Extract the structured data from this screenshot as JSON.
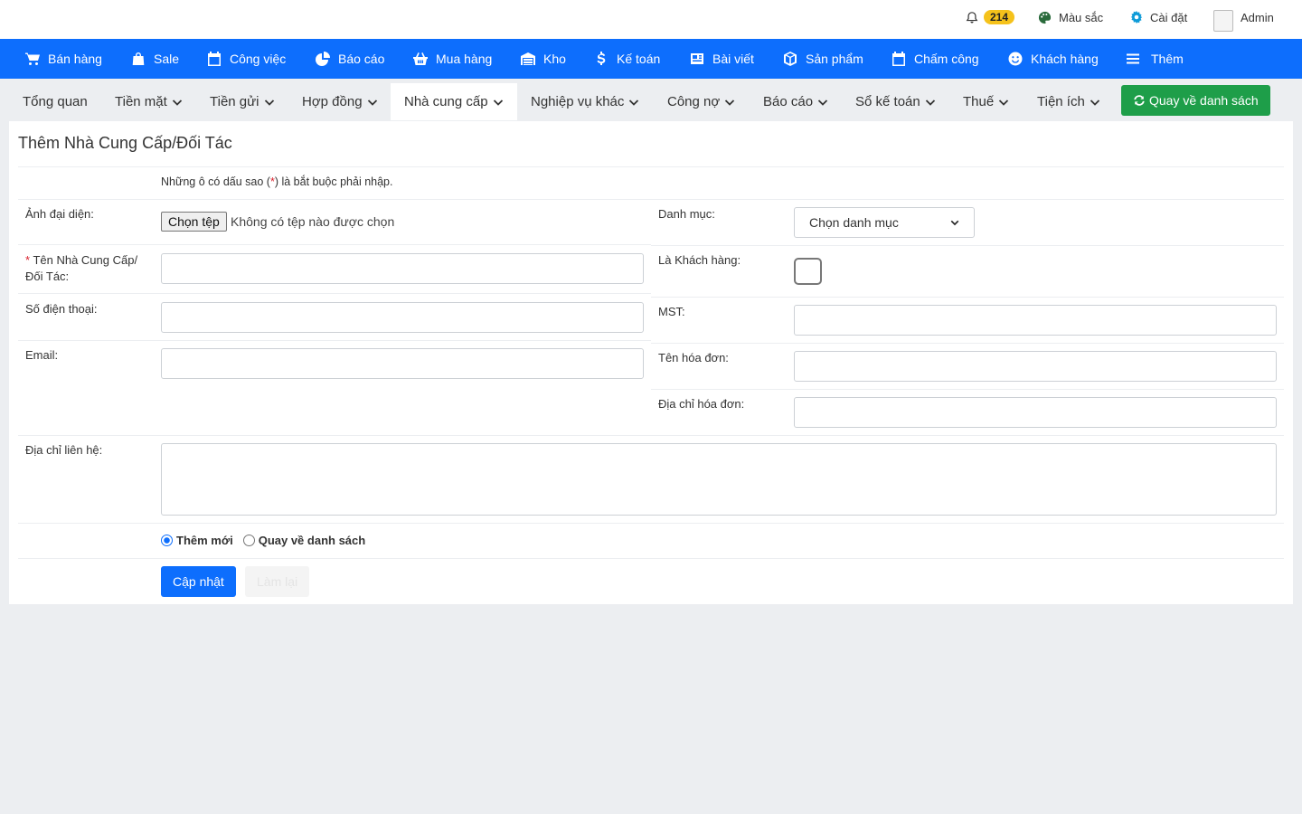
{
  "topbar": {
    "notifications": {
      "icon": "bell-icon",
      "count": "214"
    },
    "color": {
      "icon": "palette-icon",
      "label": "Màu sắc"
    },
    "settings": {
      "icon": "gear-icon",
      "label": "Cài đặt"
    },
    "user": {
      "icon": "avatar-image",
      "name": "Admin"
    }
  },
  "main_nav": [
    {
      "icon": "cart-icon",
      "label": "Bán hàng"
    },
    {
      "icon": "bag-icon",
      "label": "Sale"
    },
    {
      "icon": "calendar-icon",
      "label": "Công việc"
    },
    {
      "icon": "pie-chart-icon",
      "label": "Báo cáo"
    },
    {
      "icon": "basket-icon",
      "label": "Mua hàng"
    },
    {
      "icon": "warehouse-icon",
      "label": "Kho"
    },
    {
      "icon": "dollar-icon",
      "label": "Kế toán"
    },
    {
      "icon": "newspaper-icon",
      "label": "Bài viết"
    },
    {
      "icon": "box-icon",
      "label": "Sản phẩm"
    },
    {
      "icon": "calendar-icon",
      "label": "Chấm công"
    },
    {
      "icon": "smile-icon",
      "label": "Khách hàng"
    },
    {
      "icon": "menu-icon",
      "label": "Thêm"
    }
  ],
  "sub_nav": {
    "tabs": [
      {
        "label": "Tổng quan",
        "dropdown": false
      },
      {
        "label": "Tiền mặt",
        "dropdown": true
      },
      {
        "label": "Tiền gửi",
        "dropdown": true
      },
      {
        "label": "Hợp đồng",
        "dropdown": true
      },
      {
        "label": "Nhà cung cấp",
        "dropdown": true,
        "active": true
      },
      {
        "label": "Nghiệp vụ khác",
        "dropdown": true
      },
      {
        "label": "Công nợ",
        "dropdown": true
      },
      {
        "label": "Báo cáo",
        "dropdown": true
      },
      {
        "label": "Sổ kế toán",
        "dropdown": true
      },
      {
        "label": "Thuế",
        "dropdown": true
      },
      {
        "label": "Tiện ích",
        "dropdown": true
      }
    ],
    "back_button": {
      "icon": "refresh-icon",
      "label": "Quay về danh sách"
    }
  },
  "form": {
    "title": "Thêm Nhà Cung Cấp/Đối Tác",
    "note_before": "Những ô có dấu sao (",
    "note_star": "*",
    "note_after": ") là bắt buộc phải nhập.",
    "avatar_label": "Ảnh đại diện:",
    "file_button": "Chọn tệp",
    "file_status": "Không có tệp nào được chọn",
    "category_label": "Danh mục:",
    "category_value": "Chọn danh mục",
    "name_required": "*",
    "name_label_1": " Tên Nhà Cung Cấp/",
    "name_label_2": "Đối Tác:",
    "is_customer_label": "Là Khách hàng:",
    "is_customer_checked": false,
    "phone_label": "Số điện thoại:",
    "tax_label": "MST:",
    "email_label": "Email:",
    "invoice_name_label": "Tên hóa đơn:",
    "invoice_address_label": "Địa chỉ hóa đơn:",
    "contact_address_label": "Địa chỉ liên hệ:",
    "radio_options": [
      {
        "label": "Thêm mới",
        "checked": true
      },
      {
        "label": "Quay về danh sách",
        "checked": false
      }
    ],
    "update_button": "Cập nhật",
    "reset_button": "Làm lại"
  },
  "colors": {
    "primary": "#0d6efd",
    "success": "#1e9e49",
    "badge": "#f5c21b",
    "background": "#eceef1"
  }
}
